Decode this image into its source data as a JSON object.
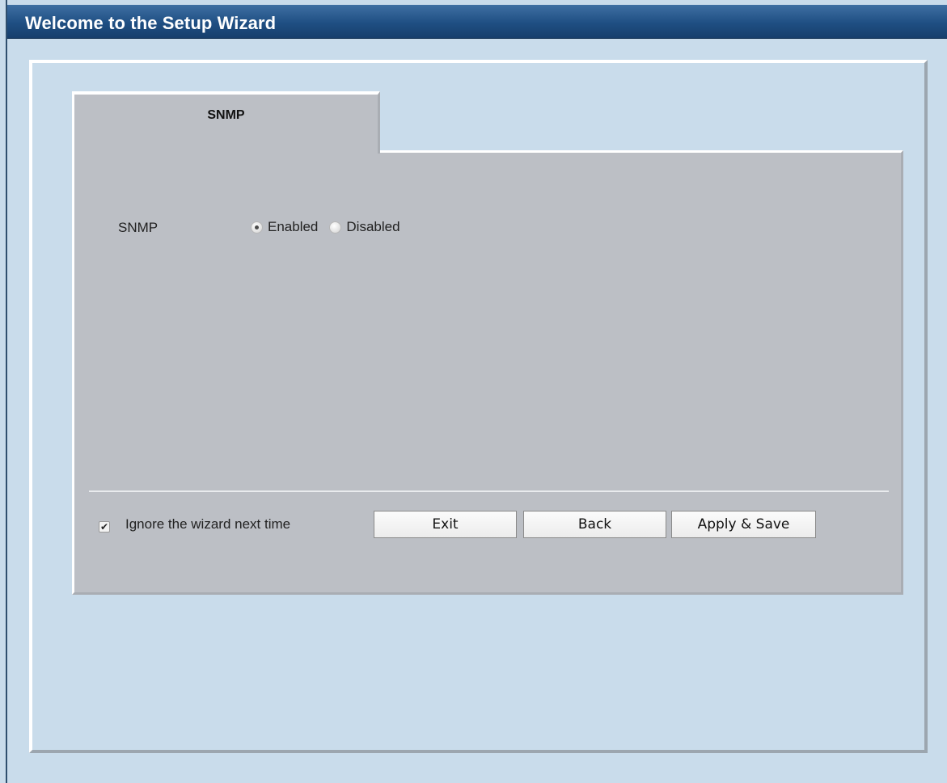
{
  "header": {
    "title": "Welcome to the Setup Wizard"
  },
  "tab": {
    "label": "SNMP"
  },
  "snmp": {
    "label": "SNMP",
    "options": [
      {
        "label": "Enabled",
        "checked": true
      },
      {
        "label": "Disabled",
        "checked": false
      }
    ]
  },
  "footer": {
    "ignore_label": "Ignore the wizard next time",
    "ignore_checked": true,
    "check_glyph": "✔",
    "buttons": {
      "exit": "Exit",
      "back": "Back",
      "apply": "Apply & Save"
    }
  },
  "colors": {
    "background": "#c9dceb",
    "header": "#1f4f83",
    "panel": "#bcbfc5"
  }
}
